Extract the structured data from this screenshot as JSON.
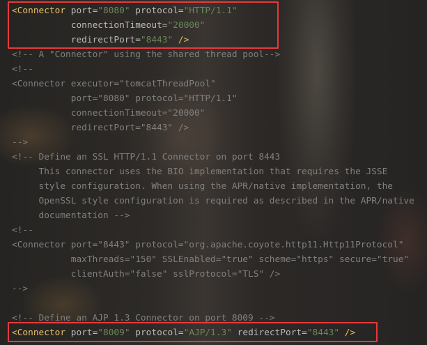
{
  "code_lines": [
    {
      "parts": [
        {
          "t": "<Connector ",
          "c": "tag"
        },
        {
          "t": "port",
          "c": "attr"
        },
        {
          "t": "=",
          "c": "plain"
        },
        {
          "t": "\"8080\"",
          "c": "val"
        },
        {
          "t": " ",
          "c": "plain"
        },
        {
          "t": "protocol",
          "c": "attr"
        },
        {
          "t": "=",
          "c": "plain"
        },
        {
          "t": "\"HTTP/1.1\"",
          "c": "val"
        }
      ]
    },
    {
      "parts": [
        {
          "t": "           ",
          "c": "plain"
        },
        {
          "t": "connectionTimeout",
          "c": "attr"
        },
        {
          "t": "=",
          "c": "plain"
        },
        {
          "t": "\"20000\"",
          "c": "val"
        }
      ]
    },
    {
      "parts": [
        {
          "t": "           ",
          "c": "plain"
        },
        {
          "t": "redirectPort",
          "c": "attr"
        },
        {
          "t": "=",
          "c": "plain"
        },
        {
          "t": "\"8443\"",
          "c": "val"
        },
        {
          "t": " />",
          "c": "tag"
        }
      ]
    },
    {
      "parts": [
        {
          "t": "<!-- A \"Connector\" using the shared thread pool-->",
          "c": "comment"
        }
      ]
    },
    {
      "parts": [
        {
          "t": "<!--",
          "c": "comment"
        }
      ]
    },
    {
      "parts": [
        {
          "t": "<Connector executor=\"tomcatThreadPool\"",
          "c": "comment"
        }
      ]
    },
    {
      "parts": [
        {
          "t": "           port=\"8080\" protocol=\"HTTP/1.1\"",
          "c": "comment"
        }
      ]
    },
    {
      "parts": [
        {
          "t": "           connectionTimeout=\"20000\"",
          "c": "comment"
        }
      ]
    },
    {
      "parts": [
        {
          "t": "           redirectPort=\"8443\" />",
          "c": "comment"
        }
      ]
    },
    {
      "parts": [
        {
          "t": "-->",
          "c": "comment"
        }
      ]
    },
    {
      "parts": [
        {
          "t": "<!-- Define an SSL HTTP/1.1 Connector on port 8443",
          "c": "comment"
        }
      ]
    },
    {
      "parts": [
        {
          "t": "     This connector uses the BIO implementation that requires the JSSE",
          "c": "comment"
        }
      ]
    },
    {
      "parts": [
        {
          "t": "     style configuration. When using the APR/native implementation, the",
          "c": "comment"
        }
      ]
    },
    {
      "parts": [
        {
          "t": "     OpenSSL style configuration is required as described in the APR/native",
          "c": "comment"
        }
      ]
    },
    {
      "parts": [
        {
          "t": "     documentation -->",
          "c": "comment"
        }
      ]
    },
    {
      "parts": [
        {
          "t": "<!--",
          "c": "comment"
        }
      ]
    },
    {
      "parts": [
        {
          "t": "<Connector port=\"8443\" protocol=\"org.apache.coyote.http11.Http11Protocol\"",
          "c": "comment"
        }
      ]
    },
    {
      "parts": [
        {
          "t": "           maxThreads=\"150\" SSLEnabled=\"true\" scheme=\"https\" secure=\"true\"",
          "c": "comment"
        }
      ]
    },
    {
      "parts": [
        {
          "t": "           clientAuth=\"false\" sslProtocol=\"TLS\" />",
          "c": "comment"
        }
      ]
    },
    {
      "parts": [
        {
          "t": "-->",
          "c": "comment"
        }
      ]
    },
    {
      "parts": [
        {
          "t": "",
          "c": "plain"
        }
      ]
    },
    {
      "parts": [
        {
          "t": "<!-- Define an AJP 1.3 Connector on port 8009 -->",
          "c": "comment"
        }
      ]
    },
    {
      "parts": [
        {
          "t": "<Connector ",
          "c": "tag"
        },
        {
          "t": "port",
          "c": "attr"
        },
        {
          "t": "=",
          "c": "plain"
        },
        {
          "t": "\"8009\"",
          "c": "val"
        },
        {
          "t": " ",
          "c": "plain"
        },
        {
          "t": "protocol",
          "c": "attr"
        },
        {
          "t": "=",
          "c": "plain"
        },
        {
          "t": "\"AJP/1.3\"",
          "c": "val"
        },
        {
          "t": " ",
          "c": "plain"
        },
        {
          "t": "redirectPort",
          "c": "attr"
        },
        {
          "t": "=",
          "c": "plain"
        },
        {
          "t": "\"8443\"",
          "c": "val"
        },
        {
          "t": " />",
          "c": "tag"
        }
      ]
    }
  ],
  "colors": {
    "tag": "#e8bf6a",
    "attribute": "#bababa",
    "value": "#6a8759",
    "comment": "#808080",
    "highlight_border": "#e63a3a"
  }
}
